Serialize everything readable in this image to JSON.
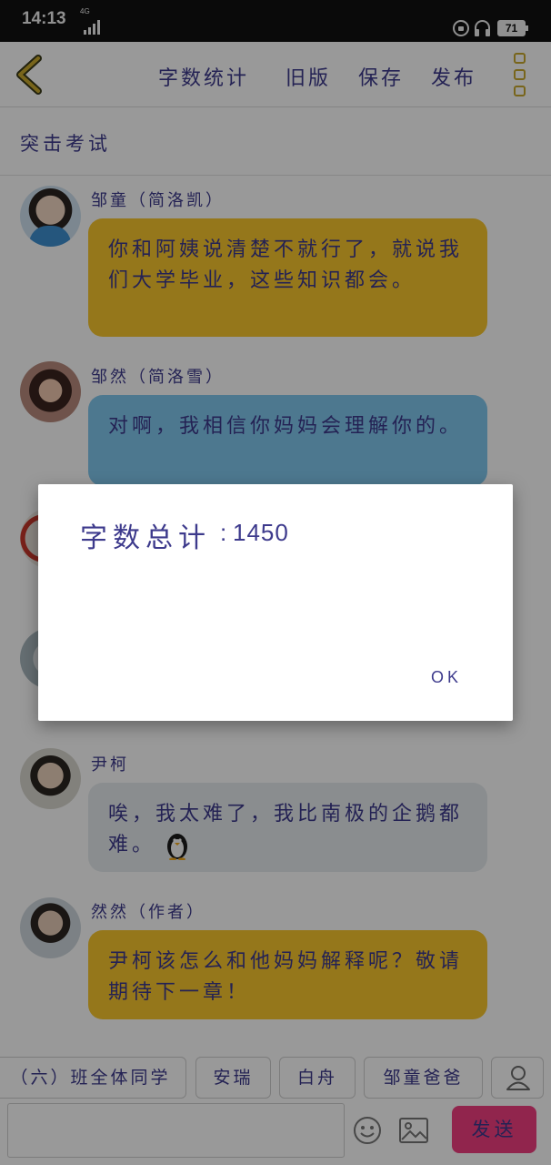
{
  "status_bar": {
    "time": "14:13",
    "network": "4G",
    "battery": "71"
  },
  "header": {
    "word_count_label": "字数统计",
    "old_version_label": "旧版",
    "save_label": "保存",
    "publish_label": "发布"
  },
  "chapter_title": "突击考试",
  "messages": [
    {
      "speaker": "邹童（简洛凯）",
      "text": "你和阿姨说清楚不就行了，就说我们大学毕业，这些知识都会。",
      "color": "yellow"
    },
    {
      "speaker": "邹然（简洛雪）",
      "text": "对啊，我相信你妈妈会理解你的。",
      "color": "blue"
    },
    {
      "speaker": "尹柯",
      "text": "唉，我太难了，我比南极的企鹅都难。",
      "color": "grey"
    },
    {
      "speaker": "然然（作者）",
      "text": "尹柯该怎么和他妈妈解释呢？敬请期待下一章！",
      "color": "yellow"
    }
  ],
  "role_chips": [
    "（六）班全体同学",
    "安瑞",
    "白舟",
    "邹童爸爸"
  ],
  "send_label": "发送",
  "dialog": {
    "label": "字数总计",
    "colon": ":",
    "value": "1450",
    "ok_label": "OK"
  },
  "icons": [
    "back-arrow-icon",
    "more-menu-icon",
    "user-icon",
    "emoji-icon",
    "image-icon",
    "penguin-icon"
  ],
  "colors": {
    "accent_yellow": "#f9c62d",
    "bubble_blue": "#81c8ef",
    "bubble_grey": "#e6ebef",
    "send_pink": "#f23f80",
    "text": "#3d3a8c"
  }
}
